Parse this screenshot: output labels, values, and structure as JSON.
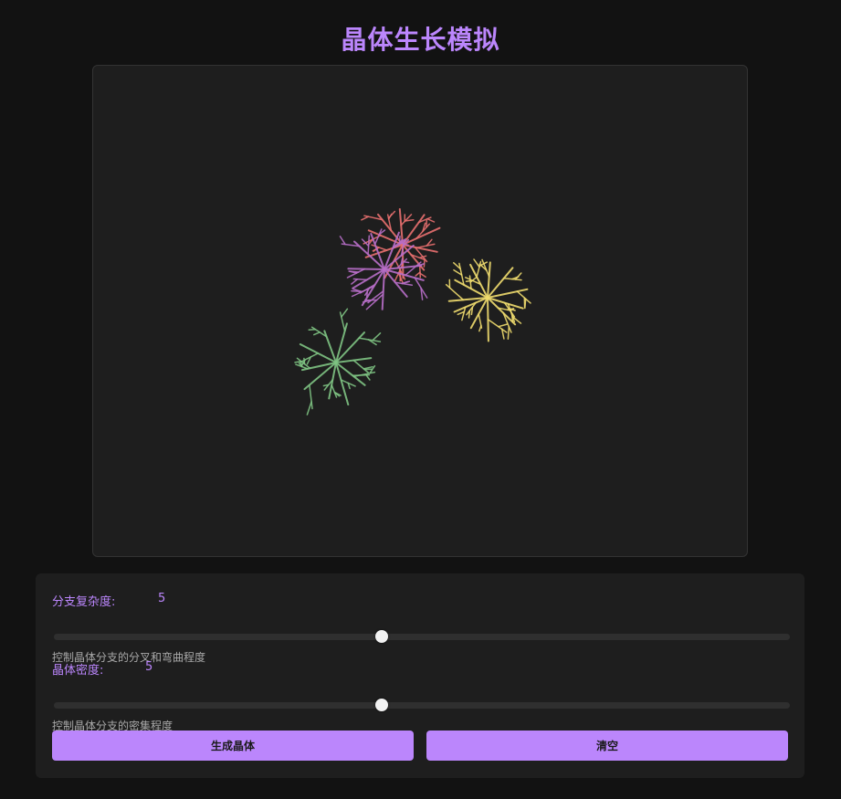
{
  "title": "晶体生长模拟",
  "controls": {
    "complexity": {
      "label": "分支复杂度:",
      "value": "5",
      "fraction": 0.445,
      "description": "控制晶体分支的分叉和弯曲程度"
    },
    "density": {
      "label": "晶体密度:",
      "value": "5",
      "fraction": 0.445,
      "description": "控制晶体分支的密集程度"
    }
  },
  "buttons": {
    "generate_label": "生成晶体",
    "clear_label": "清空"
  },
  "crystal_colors": {
    "red": "#e8706f",
    "purple": "#b86ec8",
    "yellow": "#f0dc6e",
    "green": "#7fc483"
  },
  "accent_color": "#bb86fc"
}
